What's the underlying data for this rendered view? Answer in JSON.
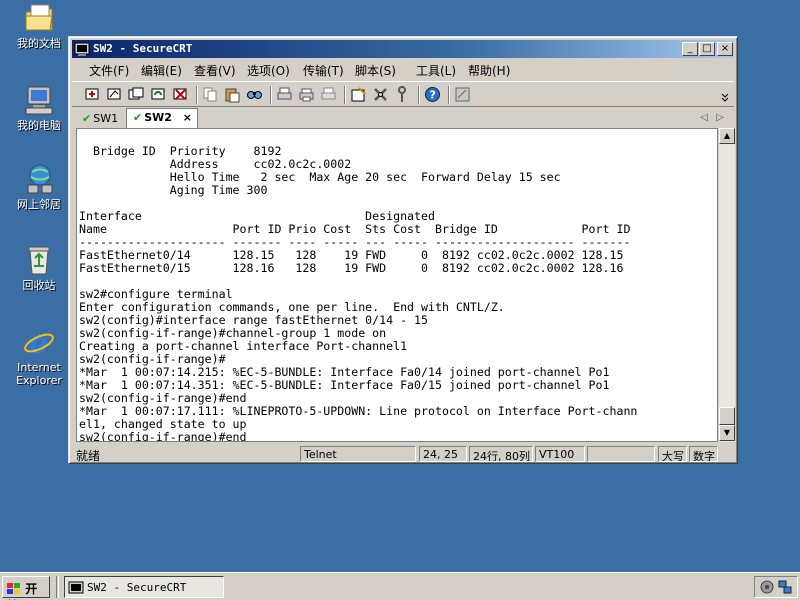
{
  "desktop": {
    "icons": [
      {
        "label": "我的文档",
        "icon": "my-documents-icon"
      },
      {
        "label": "我的电脑",
        "icon": "my-computer-icon"
      },
      {
        "label": "网上邻居",
        "icon": "network-places-icon"
      },
      {
        "label": "回收站",
        "icon": "recycle-bin-icon"
      },
      {
        "label": "Internet Explorer",
        "icon": "internet-explorer-icon"
      }
    ]
  },
  "window": {
    "title": "SW2 - SecureCRT",
    "menu": [
      "文件(F)",
      "编辑(E)",
      "查看(V)",
      "选项(O)",
      "传输(T)",
      "脚本(S)",
      "工具(L)",
      "帮助(H)"
    ],
    "tabs": [
      {
        "label": "SW1",
        "active": false
      },
      {
        "label": "SW2",
        "active": true,
        "close": "×"
      }
    ],
    "terminal_lines": [
      "",
      "  Bridge ID  Priority    8192",
      "             Address     cc02.0c2c.0002",
      "             Hello Time   2 sec  Max Age 20 sec  Forward Delay 15 sec",
      "             Aging Time 300",
      "",
      "Interface                                Designated",
      "Name                  Port ID Prio Cost  Sts Cost  Bridge ID            Port ID",
      "--------------------- ------- ---- ----- --- ----- -------------------- -------",
      "FastEthernet0/14      128.15   128    19 FWD     0  8192 cc02.0c2c.0002 128.15",
      "FastEthernet0/15      128.16   128    19 FWD     0  8192 cc02.0c2c.0002 128.16",
      "",
      "sw2#configure terminal",
      "Enter configuration commands, one per line.  End with CNTL/Z.",
      "sw2(config)#interface range fastEthernet 0/14 - 15",
      "sw2(config-if-range)#channel-group 1 mode on",
      "Creating a port-channel interface Port-channel1",
      "sw2(config-if-range)#",
      "*Mar  1 00:07:14.215: %EC-5-BUNDLE: Interface Fa0/14 joined port-channel Po1",
      "*Mar  1 00:07:14.351: %EC-5-BUNDLE: Interface Fa0/15 joined port-channel Po1",
      "sw2(config-if-range)#end",
      "*Mar  1 00:07:17.111: %LINEPROTO-5-UPDOWN: Line protocol on Interface Port-chann",
      "el1, changed state to up",
      "sw2(config-if-range)#end"
    ],
    "status": {
      "ready": "就绪",
      "protocol": "Telnet",
      "cursor": "24, 25",
      "size": "24行, 80列",
      "emulation": "VT100",
      "caps": "大写",
      "num": "数字"
    }
  },
  "taskbar": {
    "start_label": "开始",
    "task_label": "SW2 - SecureCRT"
  }
}
